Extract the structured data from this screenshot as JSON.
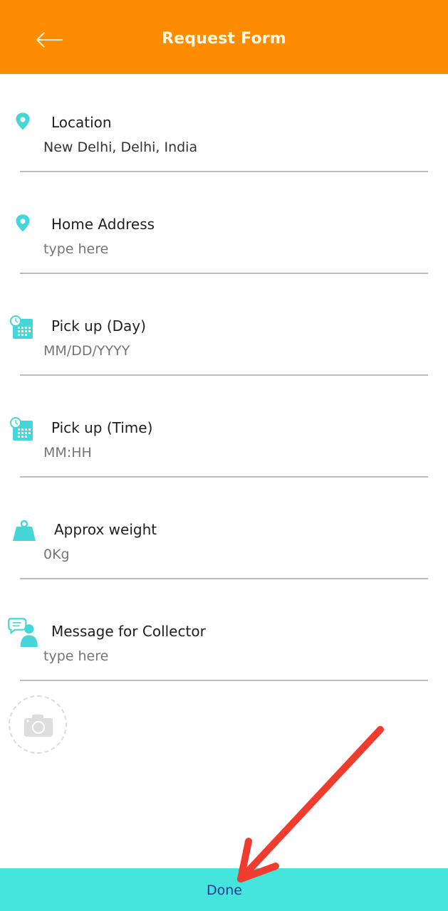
{
  "header": {
    "title": "Request Form",
    "back_icon": "arrow-left-icon",
    "background": "#FF8C00"
  },
  "fields": [
    {
      "label": "Location",
      "value": "New Delhi, Delhi, India",
      "placeholder": "",
      "icon": "map-pin-icon"
    },
    {
      "label": "Home Address",
      "value": "",
      "placeholder": "type here",
      "icon": "map-pin-icon"
    },
    {
      "label": "Pick up (Day)",
      "value": "",
      "placeholder": "MM/DD/YYYY",
      "icon": "calendar-clock-icon"
    },
    {
      "label": "Pick up (Time)",
      "value": "",
      "placeholder": "MM:HH",
      "icon": "calendar-clock-icon"
    },
    {
      "label": "Approx weight",
      "value": "",
      "placeholder": "0Kg",
      "icon": "weight-icon"
    },
    {
      "label": "Message for Collector",
      "value": "",
      "placeholder": "type here",
      "icon": "chat-user-icon"
    }
  ],
  "photo": {
    "icon": "camera-icon"
  },
  "footer": {
    "done_label": "Done",
    "background": "#43E5DC"
  },
  "annotation": {
    "icon": "red-arrow-annotation",
    "color": "#F03C2E"
  }
}
